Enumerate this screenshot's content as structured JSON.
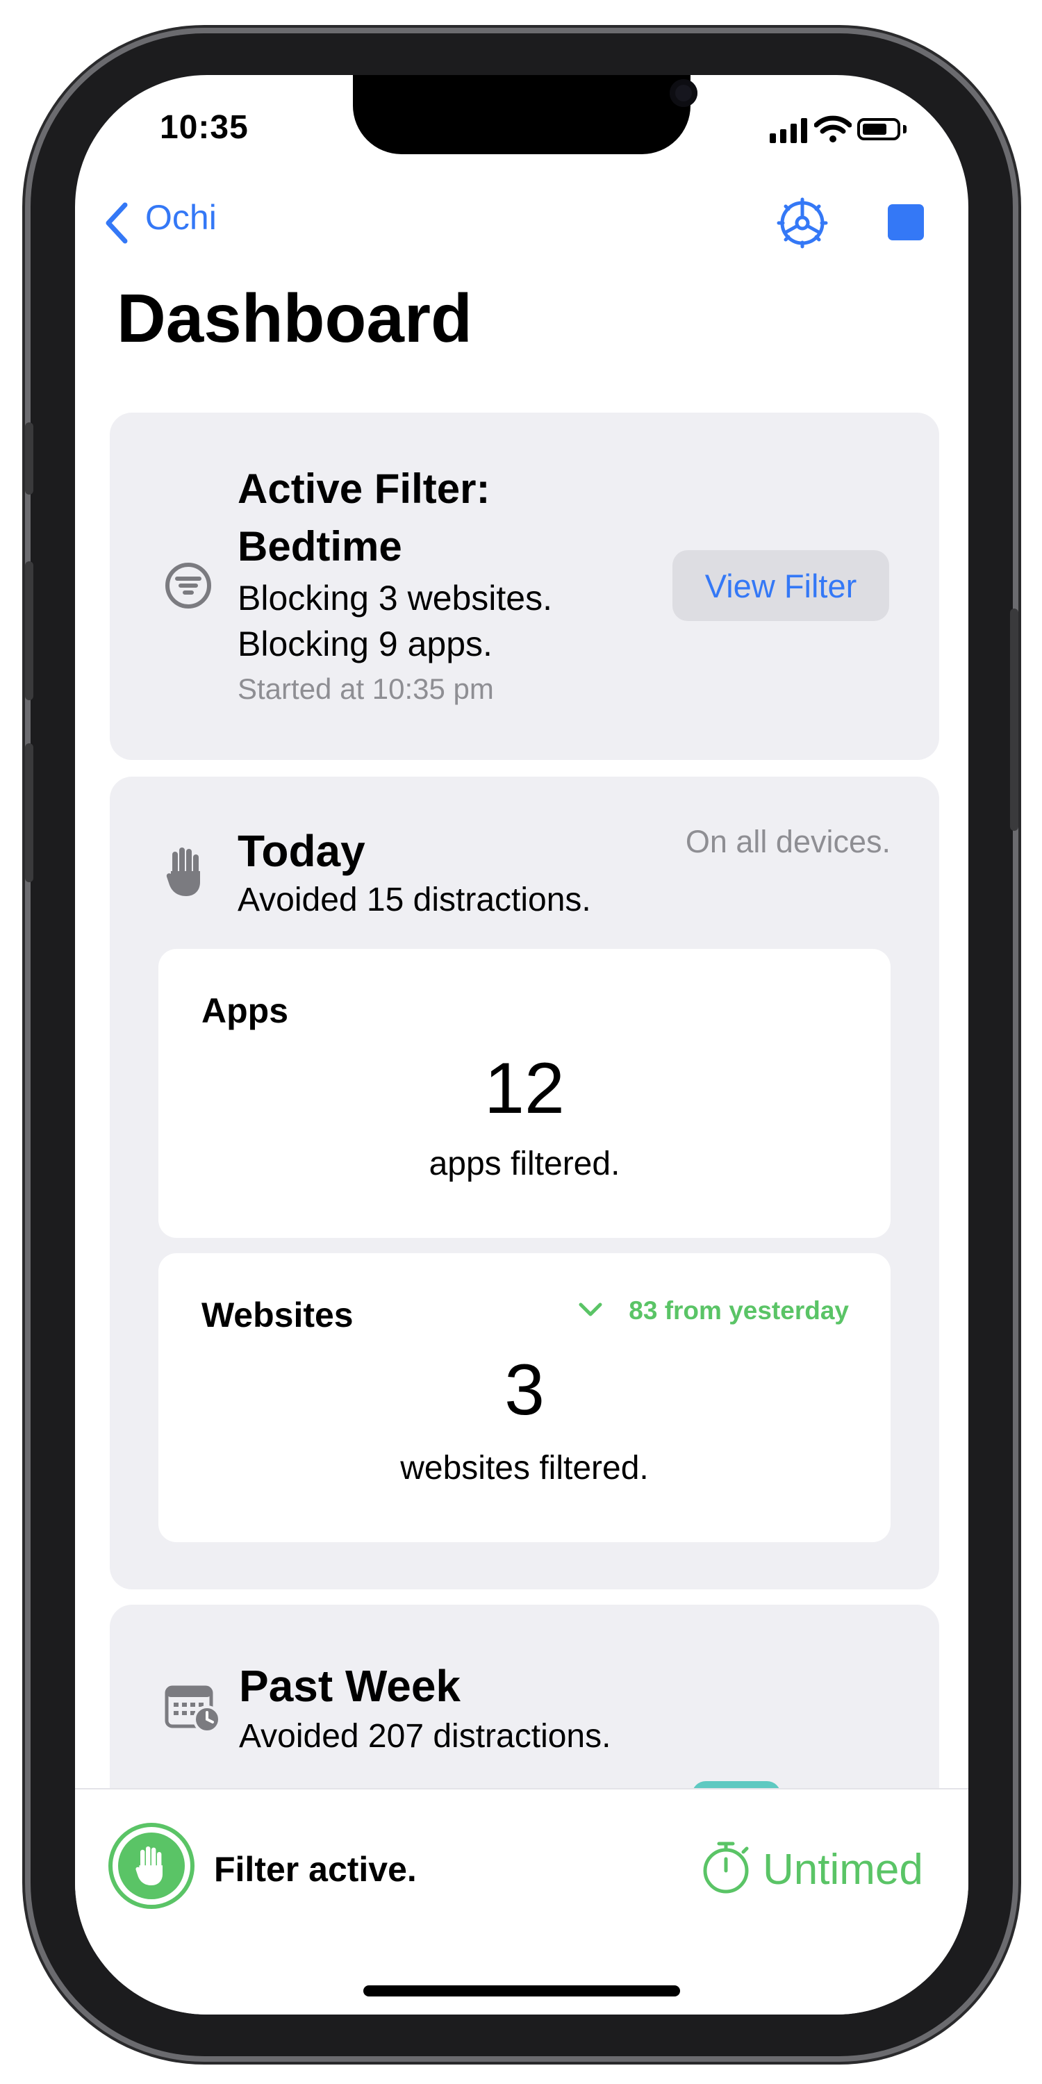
{
  "status_bar": {
    "time": "10:35"
  },
  "nav": {
    "back_label": "Ochi"
  },
  "page": {
    "title": "Dashboard"
  },
  "active_filter": {
    "title": "Active Filter: Bedtime",
    "blocking_websites": "Blocking 3 websites.",
    "blocking_apps": "Blocking 9 apps.",
    "started": "Started at 10:35 pm",
    "view_button_label": "View Filter"
  },
  "today": {
    "title": "Today",
    "subtitle": "Avoided 15 distractions.",
    "scope": "On all devices.",
    "apps": {
      "title": "Apps",
      "count": "12",
      "caption": "apps filtered."
    },
    "websites": {
      "title": "Websites",
      "trend": "83 from yesterday",
      "count": "3",
      "caption": "websites filtered."
    }
  },
  "past_week": {
    "title": "Past Week",
    "subtitle": "Avoided 207 distractions."
  },
  "bottom_bar": {
    "status": "Filter active.",
    "timer_label": "Untimed"
  },
  "colors": {
    "accent": "#3478f6",
    "active_green": "#5ac466",
    "card_bg": "#efeff3",
    "secondary_text": "#8e8e93"
  },
  "icons": [
    "back-chevron-icon",
    "settings-gear-icon",
    "stop-icon",
    "filter-icon",
    "hand-icon",
    "chevron-down-icon",
    "calendar-clock-icon",
    "stopwatch-icon"
  ]
}
